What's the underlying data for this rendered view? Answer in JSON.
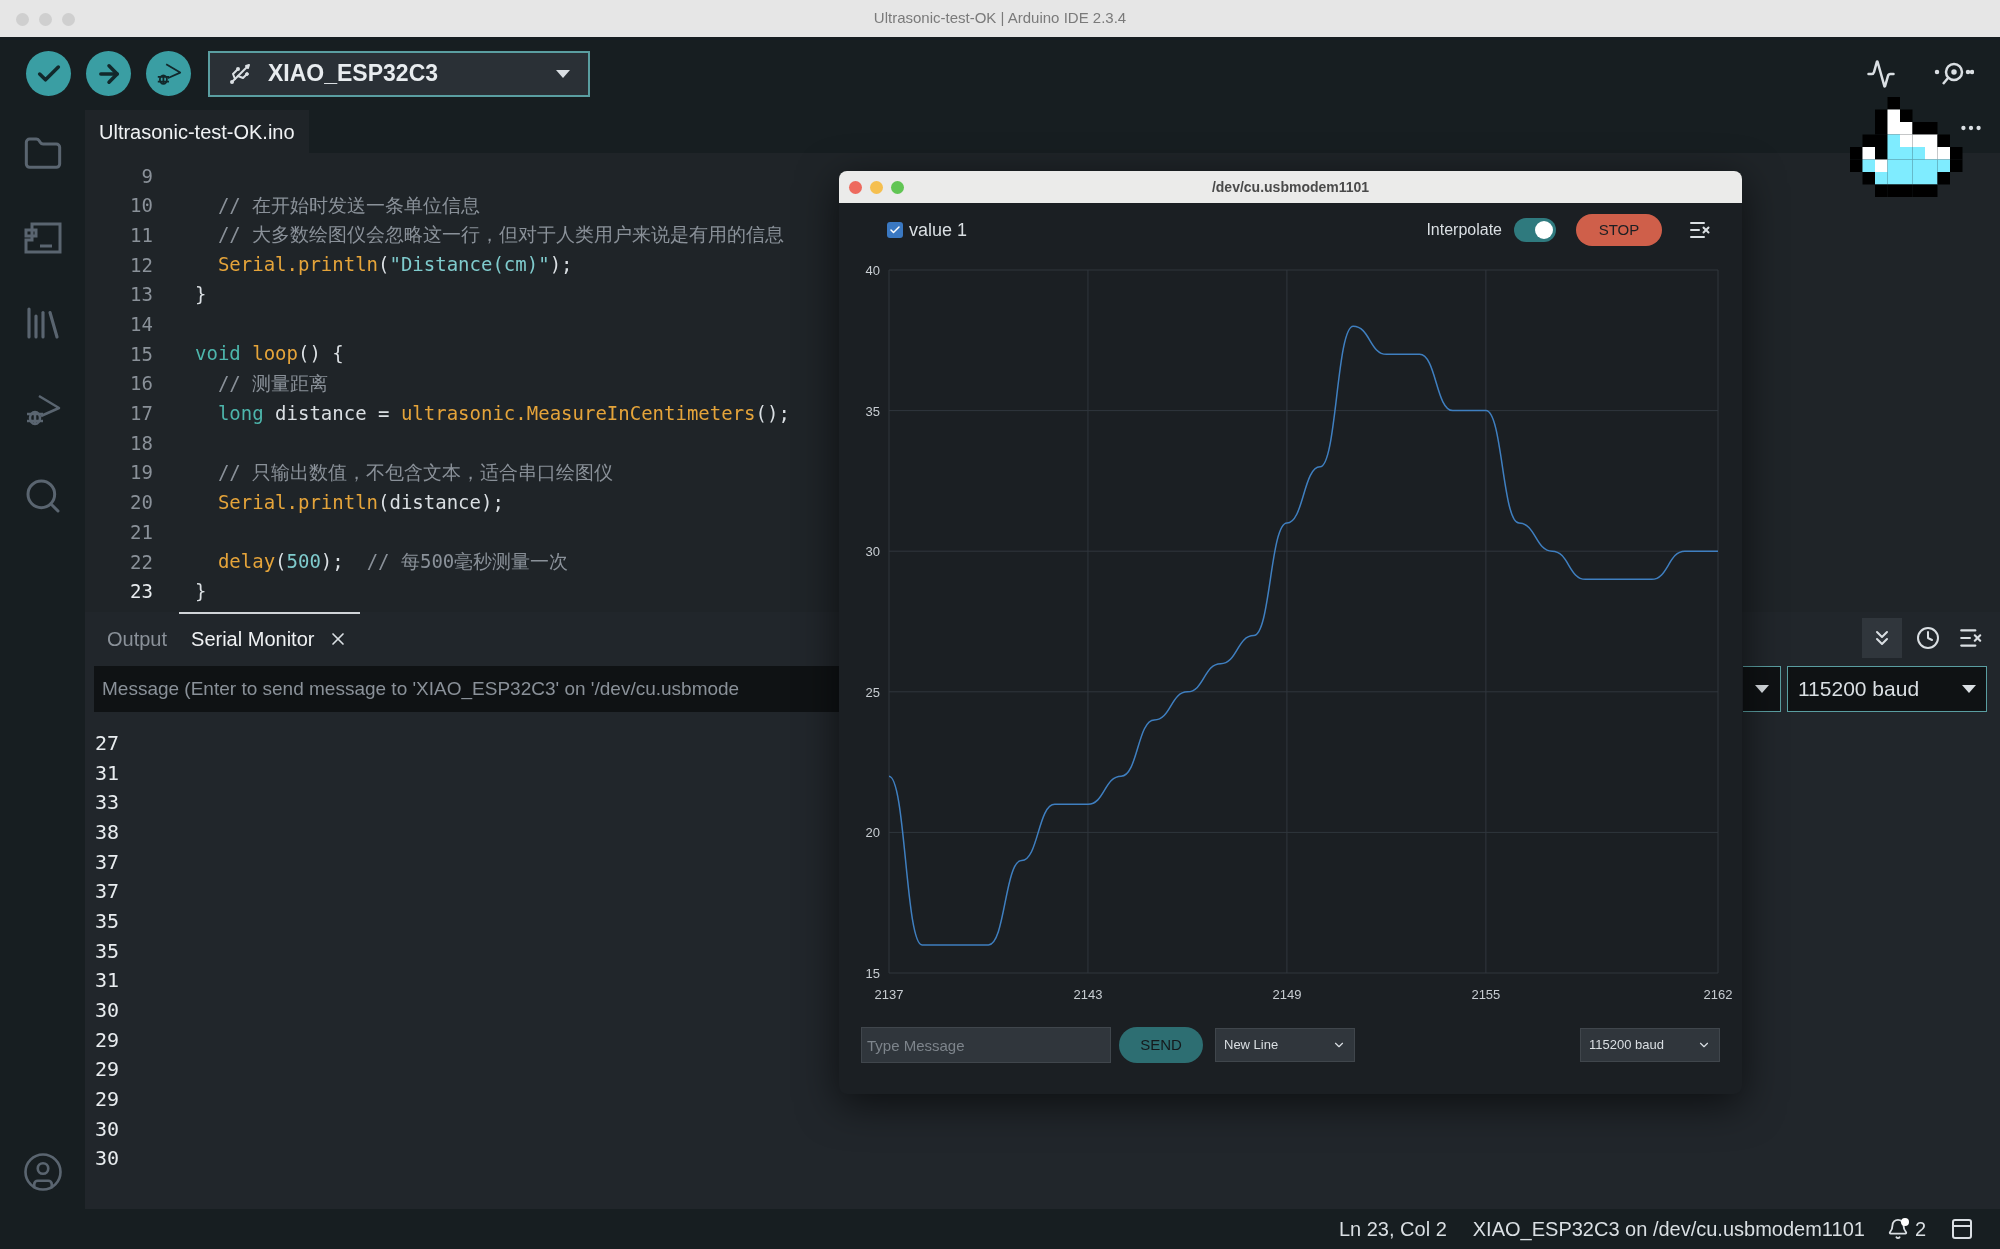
{
  "window": {
    "title": "Ultrasonic-test-OK | Arduino IDE 2.3.4"
  },
  "toolbar": {
    "board": "XIAO_ESP32C3"
  },
  "editor": {
    "tab": "Ultrasonic-test-OK.ino",
    "lines": [
      {
        "number": "9",
        "current": false
      },
      {
        "number": "10",
        "current": false,
        "tokens": [
          {
            "kind": "comment",
            "text": "  // 在开始时发送一条单位信息"
          }
        ]
      },
      {
        "number": "11",
        "current": false,
        "tokens": [
          {
            "kind": "comment",
            "text": "  // 大多数绘图仪会忽略这一行，但对于人类用户来说是有用的信息"
          }
        ]
      },
      {
        "number": "12",
        "current": false,
        "tokens": [
          {
            "kind": "func",
            "text": "  Serial."
          },
          {
            "kind": "func",
            "text": "println"
          },
          {
            "kind": "plain",
            "text": "("
          },
          {
            "kind": "string",
            "text": "\"Distance(cm)\""
          },
          {
            "kind": "plain",
            "text": ");"
          }
        ]
      },
      {
        "number": "13",
        "current": false,
        "tokens": [
          {
            "kind": "plain",
            "text": "}"
          }
        ]
      },
      {
        "number": "14",
        "current": false
      },
      {
        "number": "15",
        "current": false,
        "tokens": [
          {
            "kind": "keyword",
            "text": "void "
          },
          {
            "kind": "func",
            "text": "loop"
          },
          {
            "kind": "plain",
            "text": "() {"
          }
        ]
      },
      {
        "number": "16",
        "current": false,
        "tokens": [
          {
            "kind": "comment",
            "text": "  // 测量距离"
          }
        ]
      },
      {
        "number": "17",
        "current": false,
        "tokens": [
          {
            "kind": "keyword",
            "text": "  long"
          },
          {
            "kind": "plain",
            "text": " distance = "
          },
          {
            "kind": "func",
            "text": "ultrasonic."
          },
          {
            "kind": "func",
            "text": "MeasureInCentimeters"
          },
          {
            "kind": "plain",
            "text": "();"
          }
        ]
      },
      {
        "number": "18",
        "current": false
      },
      {
        "number": "19",
        "current": false,
        "tokens": [
          {
            "kind": "comment",
            "text": "  // 只输出数值，不包含文本，适合串口绘图仪"
          }
        ]
      },
      {
        "number": "20",
        "current": false,
        "tokens": [
          {
            "kind": "func",
            "text": "  Serial."
          },
          {
            "kind": "func",
            "text": "println"
          },
          {
            "kind": "plain",
            "text": "(distance);"
          }
        ]
      },
      {
        "number": "21",
        "current": false
      },
      {
        "number": "22",
        "current": false,
        "tokens": [
          {
            "kind": "func",
            "text": "  delay"
          },
          {
            "kind": "plain",
            "text": "("
          },
          {
            "kind": "number",
            "text": "500"
          },
          {
            "kind": "plain",
            "text": ");  "
          },
          {
            "kind": "comment",
            "text": "// 每500毫秒测量一次"
          }
        ]
      },
      {
        "number": "23",
        "current": true,
        "tokens": [
          {
            "kind": "plain",
            "text": "}"
          }
        ]
      }
    ]
  },
  "bottom_panel": {
    "tabs": [
      {
        "label": "Output",
        "selected": false
      },
      {
        "label": "Serial Monitor",
        "selected": true
      }
    ],
    "message": {
      "placeholder": "Message (Enter to send message to 'XIAO_ESP32C3' on '/dev/cu.usbmode"
    },
    "baud": "115200 baud",
    "output": [
      "27",
      "31",
      "33",
      "38",
      "37",
      "37",
      "35",
      "35",
      "31",
      "30",
      "29",
      "29",
      "29",
      "30",
      "30"
    ]
  },
  "plotter": {
    "title": "/dev/cu.usbmodem1101",
    "series_toggle": {
      "checked": true
    },
    "interpolate": {
      "label": "Interpolate",
      "on": true
    },
    "stop_button": "STOP",
    "chart_data": {
      "type": "line",
      "x": [
        2137,
        2138,
        2139,
        2140,
        2141,
        2142,
        2143,
        2144,
        2145,
        2146,
        2147,
        2148,
        2149,
        2150,
        2151,
        2152,
        2153,
        2154,
        2155,
        2156,
        2157,
        2158,
        2159,
        2160,
        2161,
        2162
      ],
      "series": [
        {
          "name": "value 1",
          "color": "#3f7fc0",
          "values": [
            22,
            16,
            16,
            16,
            19,
            21,
            21,
            22,
            24,
            25,
            26,
            27,
            31,
            33,
            38,
            37,
            37,
            35,
            35,
            31,
            30,
            29,
            29,
            29,
            30,
            30
          ]
        }
      ],
      "xlim": [
        2137,
        2162
      ],
      "ylim": [
        15,
        40
      ],
      "xticks": [
        2137,
        2143,
        2149,
        2155,
        2162
      ],
      "yticks": [
        15,
        20,
        25,
        30,
        35,
        40
      ],
      "grid": true
    },
    "message": {
      "placeholder": "Type Message"
    },
    "send_button": "SEND",
    "line_ending": "New Line",
    "baud": "115200 baud"
  },
  "status_bar": {
    "position": "Ln 23, Col 2",
    "board": "XIAO_ESP32C3 on /dev/cu.usbmodem1101",
    "notifications": "2"
  }
}
